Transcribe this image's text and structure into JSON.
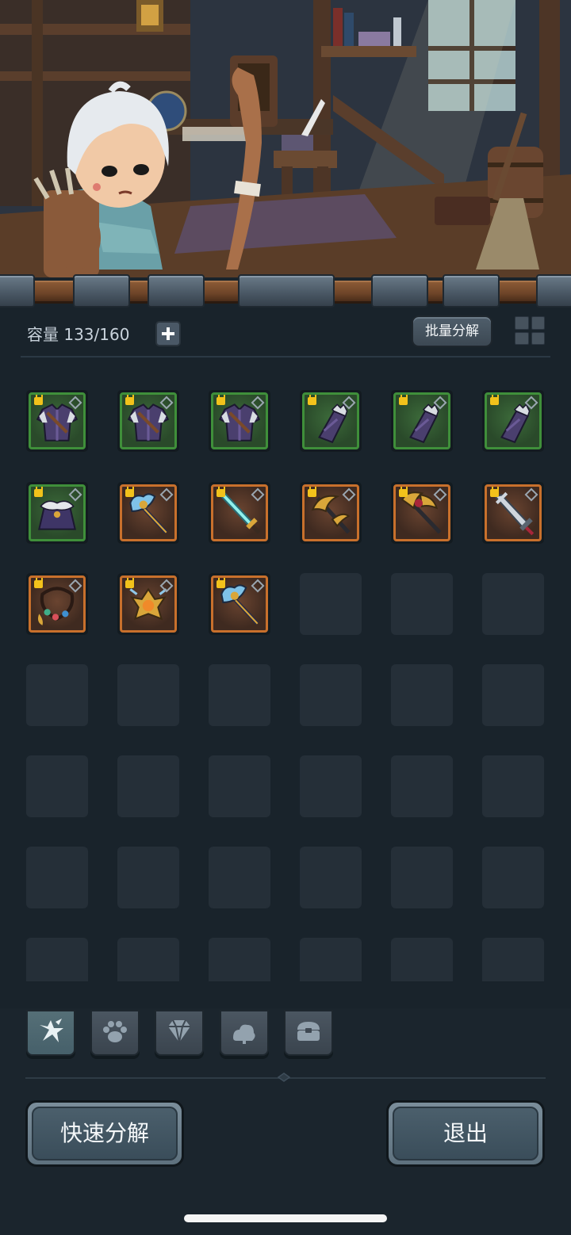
{
  "header": {
    "capacity_label": "容量 133/160",
    "batch_decompose_label": "批量分解"
  },
  "inventory": {
    "items": [
      {
        "icon": "purple-armor-icon",
        "rarity": "green",
        "locked": true
      },
      {
        "icon": "purple-armor-icon",
        "rarity": "green",
        "locked": true
      },
      {
        "icon": "purple-armor-icon",
        "rarity": "green",
        "locked": true
      },
      {
        "icon": "purple-bracer-icon",
        "rarity": "green",
        "locked": true
      },
      {
        "icon": "purple-bracer-icon",
        "rarity": "green",
        "locked": true
      },
      {
        "icon": "purple-bracer-icon",
        "rarity": "green",
        "locked": true
      },
      {
        "icon": "fur-cloak-icon",
        "rarity": "green",
        "locked": true
      },
      {
        "icon": "ice-axe-staff-icon",
        "rarity": "orange",
        "locked": true
      },
      {
        "icon": "crystal-sword-icon",
        "rarity": "orange",
        "locked": true
      },
      {
        "icon": "golden-scythe-icon",
        "rarity": "orange",
        "locked": true
      },
      {
        "icon": "crimson-scythe-icon",
        "rarity": "orange",
        "locked": true
      },
      {
        "icon": "silver-greatsword-icon",
        "rarity": "orange",
        "locked": true
      },
      {
        "icon": "gem-necklace-icon",
        "rarity": "orange",
        "locked": true
      },
      {
        "icon": "golden-amulet-icon",
        "rarity": "orange",
        "locked": true
      },
      {
        "icon": "ice-axe-staff-icon",
        "rarity": "orange",
        "locked": true
      }
    ]
  },
  "tabs": [
    {
      "name": "tab-weapons",
      "icon": "weapon-burst-icon",
      "active": true
    },
    {
      "name": "tab-pets",
      "icon": "paw-icon",
      "active": false
    },
    {
      "name": "tab-gems",
      "icon": "diamond-icon",
      "active": false
    },
    {
      "name": "tab-materials",
      "icon": "ore-icon",
      "active": false
    },
    {
      "name": "tab-chests",
      "icon": "chest-icon",
      "active": false
    }
  ],
  "footer": {
    "quick_decompose_label": "快速分解",
    "exit_label": "退出"
  },
  "colors": {
    "rarity_green": "#3f8f3a",
    "rarity_orange": "#c8702c",
    "lock": "#f2c21b",
    "background": "#19232b"
  }
}
